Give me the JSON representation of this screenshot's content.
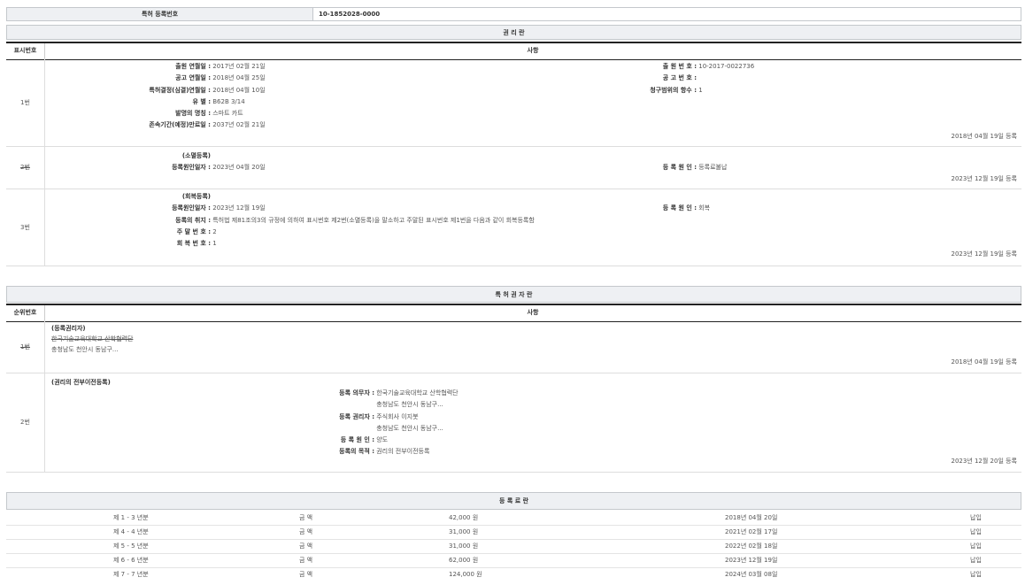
{
  "reg": {
    "label": "특허 등록번호",
    "value": "10-1852028-0000"
  },
  "rights": {
    "title": "권 리 란",
    "col_num": "표시번호",
    "col_desc": "사항",
    "rows": [
      {
        "num": "1번",
        "left": [
          {
            "k": "출원 연월일 :",
            "v": "2017년 02월 21일"
          },
          {
            "k": "공고 연월일 :",
            "v": "2018년 04월 25일"
          },
          {
            "k": "특허결정(심결)연월일 :",
            "v": "2018년 04월 10일"
          },
          {
            "k": "유 별 :",
            "v": "B62B 3/14"
          },
          {
            "k": "발명의 명칭 :",
            "v": "스마트 카트"
          },
          {
            "k": "존속기간(예정)만료일 :",
            "v": "2037년 02월 21일"
          }
        ],
        "right": [
          {
            "k": "출 원 번 호 :",
            "v": "10-2017-0022736"
          },
          {
            "k": "공 고 번 호 :",
            "v": ""
          },
          {
            "k": "청구범위의 항수 :",
            "v": "1"
          }
        ],
        "date": "2018년 04월 19일 등록"
      },
      {
        "num": "2번",
        "heading": "(소멸등록)",
        "left": [
          {
            "k": "등록원인일자 :",
            "v": "2023년 04월 20일"
          }
        ],
        "right": [
          {
            "k": "등 록 원 인 :",
            "v": "등록료불납"
          }
        ],
        "date": "2023년 12월 19일 등록"
      },
      {
        "num": "3번",
        "heading": "(회복등록)",
        "left": [
          {
            "k": "등록원인일자 :",
            "v": "2023년 12월 19일"
          },
          {
            "k": "등록의 취지 :",
            "v": "특허법 제81조의3의 규정에 의하여 표시번호 제2번(소멸등록)을 말소하고 주말된 표시번호 제1번을 다음과 같이 회복등록함"
          },
          {
            "k": "주 말 번 호 :",
            "v": "2"
          },
          {
            "k": "회 복 번 호 :",
            "v": "1"
          }
        ],
        "right": [
          {
            "k": "등 록 원 인 :",
            "v": "회복"
          }
        ],
        "date": "2023년 12월 19일 등록"
      }
    ]
  },
  "holders": {
    "title": "특 허 권 자 란",
    "col_num": "순위번호",
    "col_desc": "사항",
    "rows": [
      {
        "num": "1번",
        "heading": "(등록권리자)",
        "name": "한국기술교육대학교 산학협력단",
        "addr": "충청남도 천안시 동남구...",
        "date": "2018년 04월 19일 등록"
      },
      {
        "num": "2번",
        "heading": "(권리의 전부이전등록)",
        "items": [
          {
            "k": "등록 의무자 :",
            "v": "한국기술교육대학교 산학협력단"
          },
          {
            "k": "",
            "v": "충청남도 천안시 동남구..."
          },
          {
            "k": "등록 권리자 :",
            "v": "주식회사 이지봇"
          },
          {
            "k": "",
            "v": "충청남도 천안시 동남구..."
          },
          {
            "k": "등 록 원 인 :",
            "v": "양도"
          },
          {
            "k": "등록의 목적 :",
            "v": "권리의 전부이전등록"
          }
        ],
        "date": "2023년 12월 20일 등록"
      }
    ]
  },
  "fees": {
    "title": "등 록 료 란",
    "rows": [
      {
        "period": "제 1 - 3 년분",
        "label": "금 액",
        "amount": "42,000 원",
        "date": "2018년 04월 20일",
        "status": "납입"
      },
      {
        "period": "제 4 - 4 년분",
        "label": "금 액",
        "amount": "31,000 원",
        "date": "2021년 02월 17일",
        "status": "납입"
      },
      {
        "period": "제 5 - 5 년분",
        "label": "금 액",
        "amount": "31,000 원",
        "date": "2022년 02월 18일",
        "status": "납입"
      },
      {
        "period": "제 6 - 6 년분",
        "label": "금 액",
        "amount": "62,000 원",
        "date": "2023년 12월 19일",
        "status": "납입"
      },
      {
        "period": "제 7 - 7 년분",
        "label": "금 액",
        "amount": "124,000 원",
        "date": "2024년 03월 08일",
        "status": "납입"
      }
    ]
  }
}
